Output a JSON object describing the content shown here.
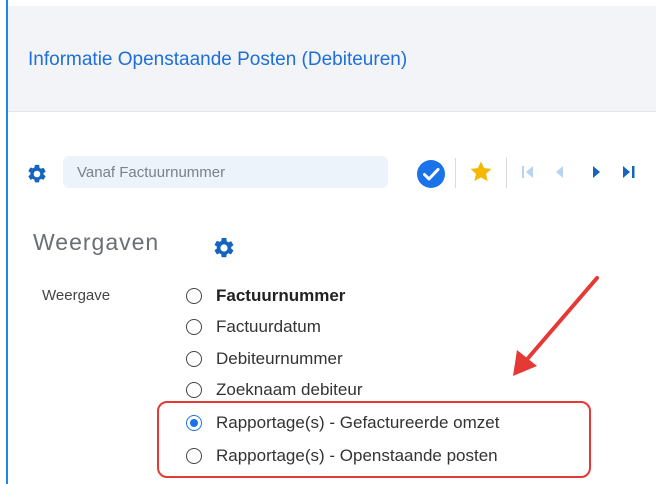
{
  "window": {
    "title": "Informatie Openstaande Posten (Debiteuren)"
  },
  "toolbar": {
    "search_placeholder": "Vanaf Factuurnummer",
    "icons": [
      "gear-icon",
      "check-circle-icon",
      "star-icon",
      "first-page-icon",
      "previous-icon",
      "next-icon",
      "last-page-icon"
    ],
    "colors": {
      "accent": "#1e6fd9",
      "check": "#1a73e8",
      "star": "#f5b800",
      "nav_disabled": "#b8d4f3",
      "nav_active": "#1565c0"
    }
  },
  "views": {
    "heading": "Weergaven",
    "field_label": "Weergave",
    "options": [
      {
        "label": "Factuurnummer",
        "selected": false,
        "bold": true
      },
      {
        "label": "Factuurdatum",
        "selected": false,
        "bold": false
      },
      {
        "label": "Debiteurnummer",
        "selected": false,
        "bold": false
      },
      {
        "label": "Zoeknaam debiteur",
        "selected": false,
        "bold": false
      },
      {
        "label": "Rapportage(s) - Gefactureerde omzet",
        "selected": true,
        "bold": false
      },
      {
        "label": "Rapportage(s) - Openstaande posten",
        "selected": false,
        "bold": false
      }
    ]
  },
  "annotation": {
    "color": "#e53935"
  }
}
